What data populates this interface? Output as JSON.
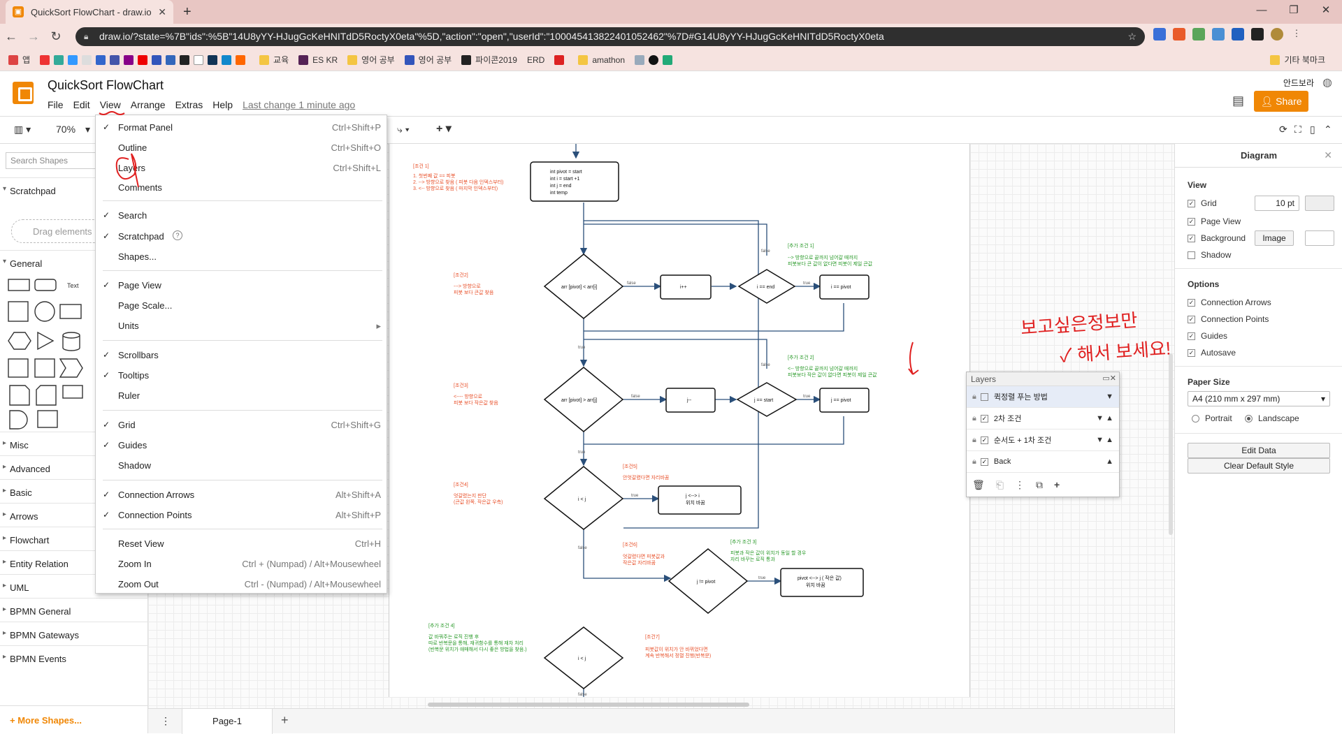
{
  "browser": {
    "tab_title": "QuickSort FlowChart - draw.io",
    "url": "draw.io/?state=%7B\"ids\":%5B\"14U8yYY-HJugGcKeHNITdD5RoctyX0eta\"%5D,\"action\":\"open\",\"userId\":\"100045413822401052462\"%7D#G14U8yYY-HJugGcKeHNITdD5RoctyX0eta",
    "bookmarks": [
      "앱",
      "교육",
      "ES KR",
      "영어 공부",
      "영어 공부",
      "파이콘2019",
      "ERD",
      "amathon"
    ],
    "other_bookmarks": "기타 북마크"
  },
  "app": {
    "title": "QuickSort FlowChart",
    "menus": [
      "File",
      "Edit",
      "View",
      "Arrange",
      "Extras",
      "Help"
    ],
    "last_change": "Last change 1 minute ago",
    "language": "안드보라",
    "share_label": "Share",
    "zoom": "70%"
  },
  "left_panel": {
    "search_placeholder": "Search Shapes",
    "scratchpad": "Scratchpad",
    "drag_hint": "Drag elements",
    "general": "General",
    "text_shape": "Text",
    "sections": [
      "Misc",
      "Advanced",
      "Basic",
      "Arrows",
      "Flowchart",
      "Entity Relation",
      "UML",
      "BPMN General",
      "BPMN Gateways",
      "BPMN Events"
    ],
    "more_shapes": "+ More Shapes..."
  },
  "view_menu": {
    "items": [
      {
        "label": "Format Panel",
        "check": "✓",
        "shortcut": "Ctrl+Shift+P"
      },
      {
        "label": "Outline",
        "check": "",
        "shortcut": "Ctrl+Shift+O"
      },
      {
        "label": "Layers",
        "check": "",
        "shortcut": "Ctrl+Shift+L"
      },
      {
        "label": "Comments",
        "check": "",
        "shortcut": ""
      },
      {
        "label": "Search",
        "check": "✓",
        "shortcut": ""
      },
      {
        "label": "Scratchpad",
        "check": "✓",
        "shortcut": ""
      },
      {
        "label": "Shapes...",
        "check": "",
        "shortcut": ""
      },
      {
        "label": "Page View",
        "check": "✓",
        "shortcut": ""
      },
      {
        "label": "Page Scale...",
        "check": "",
        "shortcut": ""
      },
      {
        "label": "Units",
        "check": "",
        "shortcut": "▸"
      },
      {
        "label": "Scrollbars",
        "check": "✓",
        "shortcut": ""
      },
      {
        "label": "Tooltips",
        "check": "✓",
        "shortcut": ""
      },
      {
        "label": "Ruler",
        "check": "",
        "shortcut": ""
      },
      {
        "label": "Grid",
        "check": "✓",
        "shortcut": "Ctrl+Shift+G"
      },
      {
        "label": "Guides",
        "check": "✓",
        "shortcut": ""
      },
      {
        "label": "Shadow",
        "check": "",
        "shortcut": ""
      },
      {
        "label": "Connection Arrows",
        "check": "✓",
        "shortcut": "Alt+Shift+A"
      },
      {
        "label": "Connection Points",
        "check": "✓",
        "shortcut": "Alt+Shift+P"
      },
      {
        "label": "Reset View",
        "check": "",
        "shortcut": "Ctrl+H"
      },
      {
        "label": "Zoom In",
        "check": "",
        "shortcut": "Ctrl + (Numpad) / Alt+Mousewheel"
      },
      {
        "label": "Zoom Out",
        "check": "",
        "shortcut": "Ctrl - (Numpad) / Alt+Mousewheel"
      }
    ]
  },
  "layers_panel": {
    "title": "Layers",
    "layers": [
      {
        "name": "퀵정렬 푸는 방법",
        "visible": false
      },
      {
        "name": "2차 조건",
        "visible": true
      },
      {
        "name": "순서도 + 1차 조건",
        "visible": true
      },
      {
        "name": "Back",
        "visible": true
      }
    ]
  },
  "right_panel": {
    "title": "Diagram",
    "view_heading": "View",
    "grid_label": "Grid",
    "grid_size": "10 pt",
    "page_view_label": "Page View",
    "background_label": "Background",
    "image_btn": "Image",
    "shadow_label": "Shadow",
    "options_heading": "Options",
    "connection_arrows": "Connection Arrows",
    "connection_points": "Connection Points",
    "guides": "Guides",
    "autosave": "Autosave",
    "paper_size_heading": "Paper Size",
    "paper_size": "A4 (210 mm x 297 mm)",
    "portrait": "Portrait",
    "landscape": "Landscape",
    "edit_data": "Edit Data",
    "clear_default_style": "Clear Default Style"
  },
  "page_tab": "Page-1",
  "annotation": {
    "line1": "보고싶은정보만",
    "line2": "✓ 해서 보세요!"
  },
  "flowchart": {
    "init_box": [
      "int pivot = start",
      "int i = start +1",
      "int j = end",
      "int temp"
    ],
    "d1": "arr [pivot] < arr[i]",
    "d2": "arr [pivot] > arr[j]",
    "d3": "i < j",
    "d4": "i == end",
    "d5": "j == start",
    "d6": "j != pivot",
    "d7": "i < j",
    "b_ipp": "i++",
    "b_ipivot": "i == pivot",
    "b_jmm": "j--",
    "b_jpivot": "j == pivot",
    "b_swap": [
      "j <--> i",
      "위치 바꿈"
    ],
    "b_pswap": [
      "pivot <--> j ( 작은 값)",
      "위치 바꿈"
    ],
    "lbl_false": "false",
    "lbl_true": "true",
    "notes": {
      "c1_title": "[조건 1]",
      "c1_text": [
        "1. 첫번째 값 == 피봇",
        "2. --> 방향으로 찾음 ( 피봇 다음 인덱스부터)",
        "3. <-- 방향으로 찾음 ( 마지막 인덱스부터)"
      ],
      "c2_title": "[조건2]",
      "c2_text": [
        "---> 방향으로",
        "피봇 보다 큰값 찾음"
      ],
      "c3_title": "[조건3]",
      "c3_text": [
        "<---- 방향으로",
        "피봇 보다 작은값 찾음"
      ],
      "c4_title": "[조건4]",
      "c4_text": [
        "엇갈렸는지 판단",
        "(큰값 왼쪽, 작은값 우측)"
      ],
      "c5_title": "[조건5]",
      "c5_text": [
        "안엇갈렸다면 자리바꿈"
      ],
      "c6_title": "[조건6]",
      "c6_text": [
        "엇갈렸다면 피봇값과",
        "작은값 자리바꿈"
      ],
      "c7_title": "[조건7]",
      "c7_text": [
        "피봇값이 위치가 안 바뀌었다면",
        "계속 반복해서 정렬 진행(반복문)"
      ],
      "a1_title": "[추가 조건 1]",
      "a1_text": [
        "--> 방향으로 끝까지 넘어갈 때까지",
        "피봇보다 큰 값이 없다면 피봇이 제일 큰값"
      ],
      "a2_title": "[추가 조건 2]",
      "a2_text": [
        "<-- 방향으로 끝까지 넘어갈 때까지",
        "피봇보다 작은 값이 없다면 피봇이 제일 큰값"
      ],
      "a3_title": "[추가 조건 3]",
      "a3_text": [
        "피봇과 작은 값이 위치가 동일 할 경우",
        "자리 바꾸는 로직 통과"
      ],
      "a4_title": "[추가 조건 4]",
      "a4_text": [
        "값 바꿔주는 로직 진행 후",
        "따로 반복문을 통해, 재귀함수를 통해 재차 처리",
        "(반복문 위치가 애매해서 다시 좋은 방법을 찾음.)"
      ]
    }
  }
}
